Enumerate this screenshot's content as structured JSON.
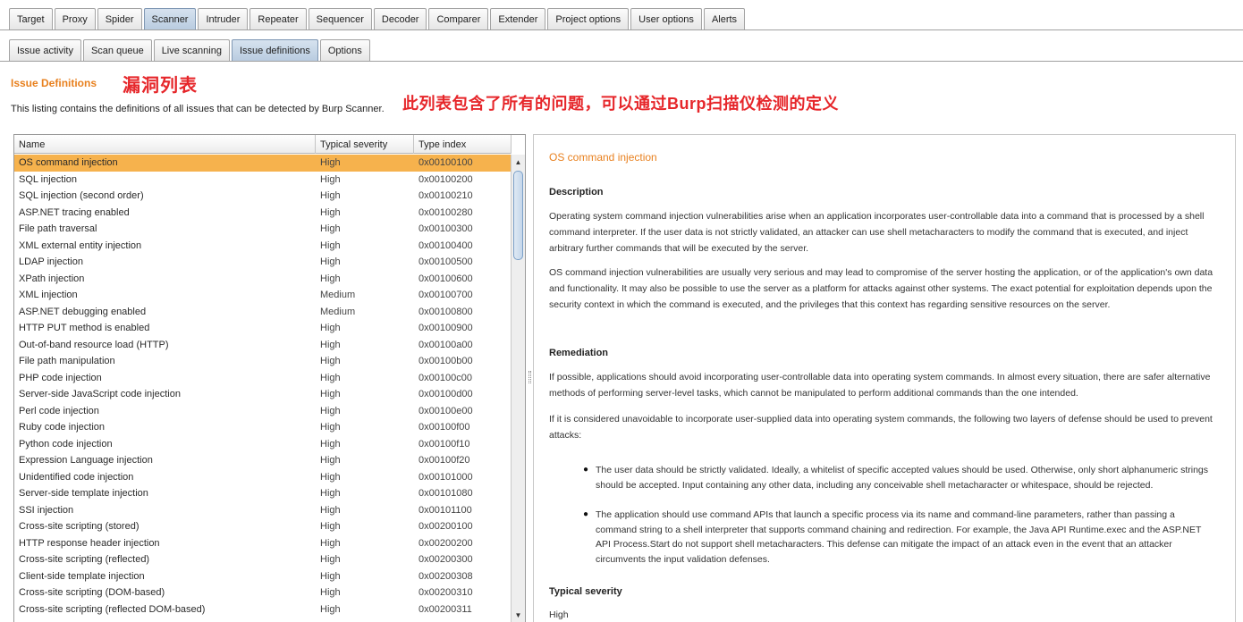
{
  "main_tabs": [
    {
      "label": "Target",
      "active": false
    },
    {
      "label": "Proxy",
      "active": false
    },
    {
      "label": "Spider",
      "active": false
    },
    {
      "label": "Scanner",
      "active": true
    },
    {
      "label": "Intruder",
      "active": false
    },
    {
      "label": "Repeater",
      "active": false
    },
    {
      "label": "Sequencer",
      "active": false
    },
    {
      "label": "Decoder",
      "active": false
    },
    {
      "label": "Comparer",
      "active": false
    },
    {
      "label": "Extender",
      "active": false
    },
    {
      "label": "Project options",
      "active": false
    },
    {
      "label": "User options",
      "active": false
    },
    {
      "label": "Alerts",
      "active": false
    }
  ],
  "sub_tabs": [
    {
      "label": "Issue activity",
      "active": false
    },
    {
      "label": "Scan queue",
      "active": false
    },
    {
      "label": "Live scanning",
      "active": false
    },
    {
      "label": "Issue definitions",
      "active": true
    },
    {
      "label": "Options",
      "active": false
    }
  ],
  "heading": {
    "title": "Issue Definitions",
    "description": "This listing contains the definitions of all issues that can be detected by Burp Scanner."
  },
  "annotations": {
    "title": "漏洞列表",
    "description": "此列表包含了所有的问题，可以通过Burp扫描仪检测的定义"
  },
  "table": {
    "columns": {
      "name": "Name",
      "severity": "Typical severity",
      "type_index": "Type index"
    },
    "rows": [
      {
        "name": "OS command injection",
        "severity": "High",
        "type_index": "0x00100100",
        "selected": true
      },
      {
        "name": "SQL injection",
        "severity": "High",
        "type_index": "0x00100200"
      },
      {
        "name": "SQL injection (second order)",
        "severity": "High",
        "type_index": "0x00100210"
      },
      {
        "name": "ASP.NET tracing enabled",
        "severity": "High",
        "type_index": "0x00100280"
      },
      {
        "name": "File path traversal",
        "severity": "High",
        "type_index": "0x00100300"
      },
      {
        "name": "XML external entity injection",
        "severity": "High",
        "type_index": "0x00100400"
      },
      {
        "name": "LDAP injection",
        "severity": "High",
        "type_index": "0x00100500"
      },
      {
        "name": "XPath injection",
        "severity": "High",
        "type_index": "0x00100600"
      },
      {
        "name": "XML injection",
        "severity": "Medium",
        "type_index": "0x00100700"
      },
      {
        "name": "ASP.NET debugging enabled",
        "severity": "Medium",
        "type_index": "0x00100800"
      },
      {
        "name": "HTTP PUT method is enabled",
        "severity": "High",
        "type_index": "0x00100900"
      },
      {
        "name": "Out-of-band resource load (HTTP)",
        "severity": "High",
        "type_index": "0x00100a00"
      },
      {
        "name": "File path manipulation",
        "severity": "High",
        "type_index": "0x00100b00"
      },
      {
        "name": "PHP code injection",
        "severity": "High",
        "type_index": "0x00100c00"
      },
      {
        "name": "Server-side JavaScript code injection",
        "severity": "High",
        "type_index": "0x00100d00"
      },
      {
        "name": "Perl code injection",
        "severity": "High",
        "type_index": "0x00100e00"
      },
      {
        "name": "Ruby code injection",
        "severity": "High",
        "type_index": "0x00100f00"
      },
      {
        "name": "Python code injection",
        "severity": "High",
        "type_index": "0x00100f10"
      },
      {
        "name": "Expression Language injection",
        "severity": "High",
        "type_index": "0x00100f20"
      },
      {
        "name": "Unidentified code injection",
        "severity": "High",
        "type_index": "0x00101000"
      },
      {
        "name": "Server-side template injection",
        "severity": "High",
        "type_index": "0x00101080"
      },
      {
        "name": "SSI injection",
        "severity": "High",
        "type_index": "0x00101100"
      },
      {
        "name": "Cross-site scripting (stored)",
        "severity": "High",
        "type_index": "0x00200100"
      },
      {
        "name": "HTTP response header injection",
        "severity": "High",
        "type_index": "0x00200200"
      },
      {
        "name": "Cross-site scripting (reflected)",
        "severity": "High",
        "type_index": "0x00200300"
      },
      {
        "name": "Client-side template injection",
        "severity": "High",
        "type_index": "0x00200308"
      },
      {
        "name": "Cross-site scripting (DOM-based)",
        "severity": "High",
        "type_index": "0x00200310"
      },
      {
        "name": "Cross-site scripting (reflected DOM-based)",
        "severity": "High",
        "type_index": "0x00200311"
      }
    ]
  },
  "detail": {
    "title": "OS command injection",
    "description_heading": "Description",
    "description_p1": "Operating system command injection vulnerabilities arise when an application incorporates user-controllable data into a command that is processed by a shell command interpreter. If the user data is not strictly validated, an attacker can use shell metacharacters to modify the command that is executed, and inject arbitrary further commands that will be executed by the server.",
    "description_p2": "OS command injection vulnerabilities are usually very serious and may lead to compromise of the server hosting the application, or of the application's own data and functionality. It may also be possible to use the server as a platform for attacks against other systems. The exact potential for exploitation depends upon the security context in which the command is executed, and the privileges that this context has regarding sensitive resources on the server.",
    "remediation_heading": "Remediation",
    "remediation_p1": "If possible, applications should avoid incorporating user-controllable data into operating system commands. In almost every situation, there are safer alternative methods of performing server-level tasks, which cannot be manipulated to perform additional commands than the one intended.",
    "remediation_p2": "If it is considered unavoidable to incorporate user-supplied data into operating system commands, the following two layers of defense should be used to prevent attacks:",
    "bullet1": "The user data should be strictly validated. Ideally, a whitelist of specific accepted values should be used. Otherwise, only short alphanumeric strings should be accepted. Input containing any other data, including any conceivable shell metacharacter or whitespace, should be rejected.",
    "bullet2": "The application should use command APIs that launch a specific process via its name and command-line parameters, rather than passing a command string to a shell interpreter that supports command chaining and redirection. For example, the Java API Runtime.exec and the ASP.NET API Process.Start do not support shell metacharacters. This defense can mitigate the impact of an attack even in the event that an attacker circumvents the input validation defenses.",
    "bullet_symbol": "●",
    "severity_heading": "Typical severity",
    "severity_value": "High"
  },
  "scrollbar": {
    "up_arrow": "▲",
    "down_arrow": "▼"
  }
}
